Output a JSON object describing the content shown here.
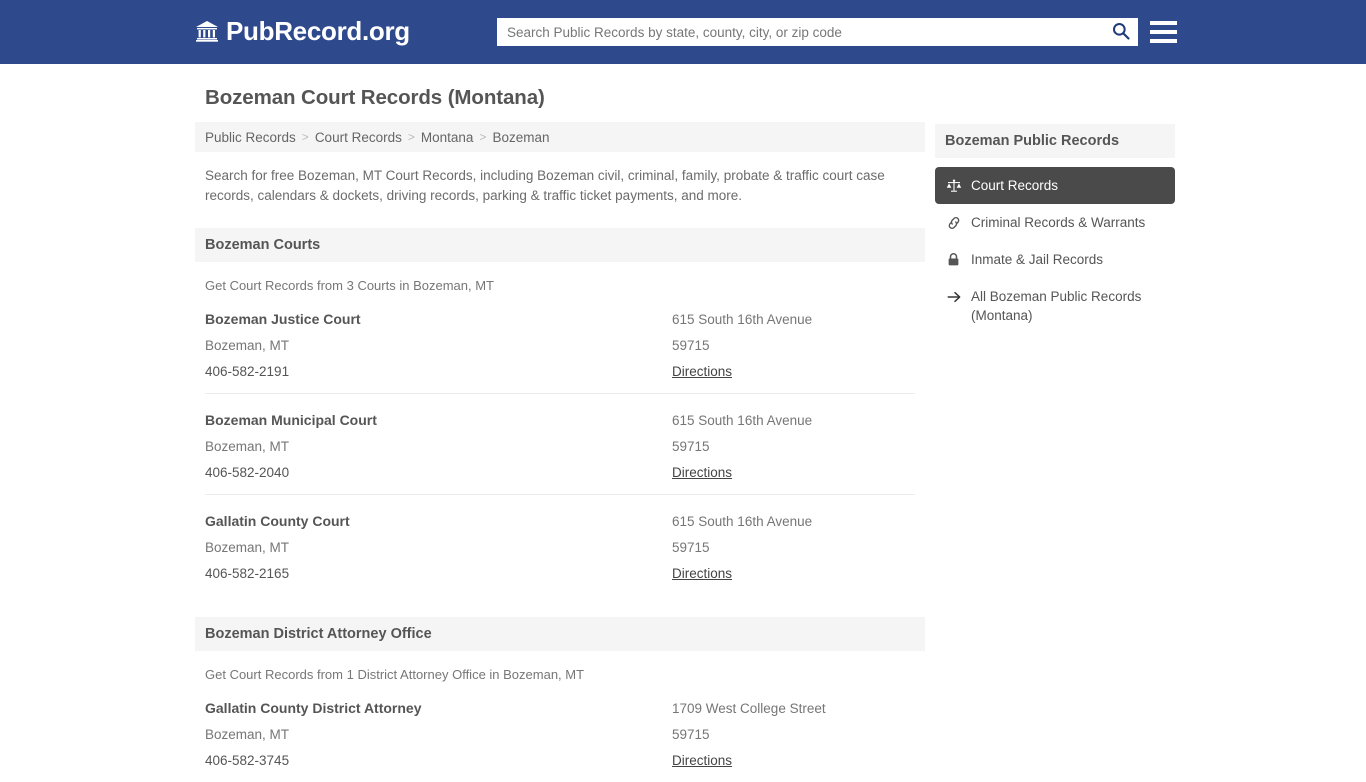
{
  "header": {
    "brand_name": "PubRecord.org",
    "brand_icon": "bank-building-icon",
    "search": {
      "placeholder": "Search Public Records by state, county, city, or zip code",
      "value": "",
      "icon": "search-icon"
    },
    "menu_icon": "hamburger-menu-icon",
    "background_color": "#2e4a8c"
  },
  "main": {
    "page_title": "Bozeman Court Records (Montana)",
    "breadcrumb": [
      {
        "label": "Public Records"
      },
      {
        "label": "Court Records"
      },
      {
        "label": "Montana"
      },
      {
        "label": "Bozeman"
      }
    ],
    "breadcrumb_separator": ">",
    "intro": "Search for free Bozeman, MT Court Records, including Bozeman civil, criminal, family, probate & traffic court case records, calendars & dockets, driving records, parking & traffic ticket payments, and more.",
    "sections": [
      {
        "heading": "Bozeman Courts",
        "subheading": "Get Court Records from 3 Courts in Bozeman, MT",
        "entries": [
          {
            "name": "Bozeman Justice Court",
            "city_state": "Bozeman, MT",
            "phone": "406-582-2191",
            "street": "615 South 16th Avenue",
            "zip": "59715",
            "directions_label": "Directions"
          },
          {
            "name": "Bozeman Municipal Court",
            "city_state": "Bozeman, MT",
            "phone": "406-582-2040",
            "street": "615 South 16th Avenue",
            "zip": "59715",
            "directions_label": "Directions"
          },
          {
            "name": "Gallatin County Court",
            "city_state": "Bozeman, MT",
            "phone": "406-582-2165",
            "street": "615 South 16th Avenue",
            "zip": "59715",
            "directions_label": "Directions"
          }
        ]
      },
      {
        "heading": "Bozeman District Attorney Office",
        "subheading": "Get Court Records from 1 District Attorney Office in Bozeman, MT",
        "entries": [
          {
            "name": "Gallatin County District Attorney",
            "city_state": "Bozeman, MT",
            "phone": "406-582-3745",
            "street": "1709 West College Street",
            "zip": "59715",
            "directions_label": "Directions"
          }
        ]
      }
    ]
  },
  "sidebar": {
    "title": "Bozeman Public Records",
    "active_background": "#4a4a4a",
    "items": [
      {
        "label": "Court Records",
        "icon": "balance-scale-icon",
        "active": true
      },
      {
        "label": "Criminal Records & Warrants",
        "icon": "link-chain-icon",
        "active": false
      },
      {
        "label": "Inmate & Jail Records",
        "icon": "lock-icon",
        "active": false
      },
      {
        "label": "All Bozeman Public Records (Montana)",
        "icon": "arrow-right-icon",
        "active": false
      }
    ]
  }
}
